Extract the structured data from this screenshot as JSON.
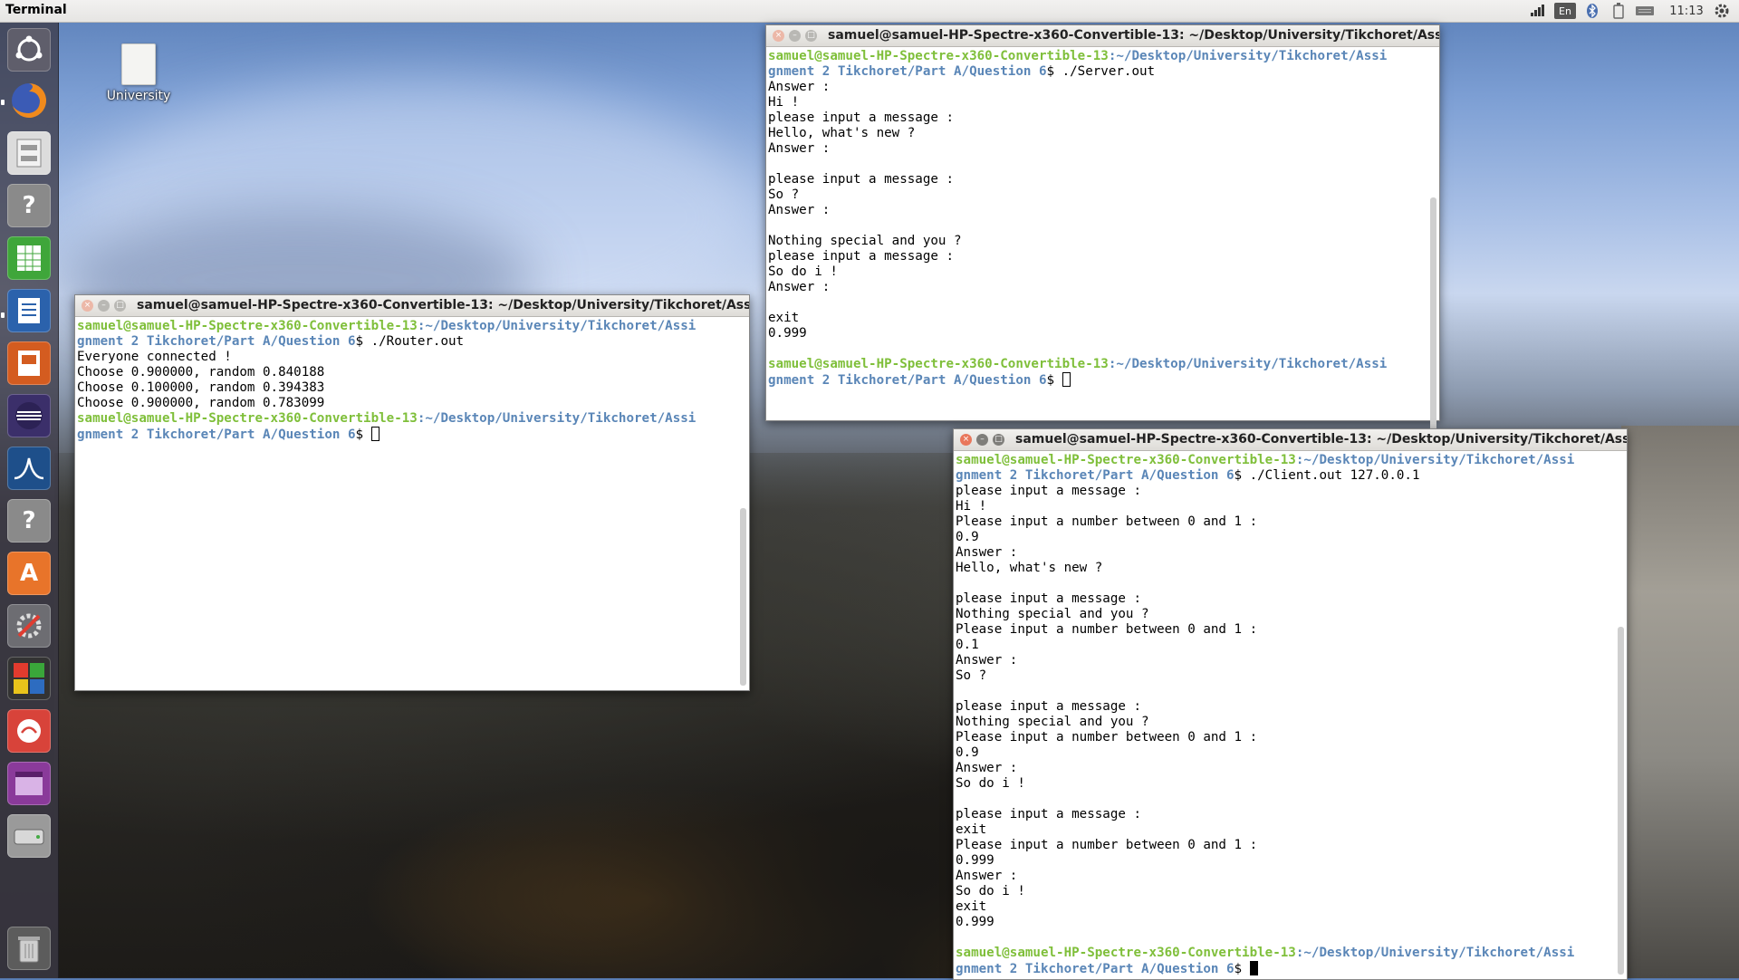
{
  "topbar": {
    "app_title": "Terminal",
    "keyboard_layout": "En",
    "clock": "11:13"
  },
  "launcher": {
    "items": [
      {
        "name": "Dash home",
        "icon": "ubuntu-logo-icon"
      },
      {
        "name": "Firefox",
        "icon": "firefox-icon"
      },
      {
        "name": "Files",
        "icon": "file-cabinet-icon"
      },
      {
        "name": "Unknown app",
        "icon": "question-mark-icon"
      },
      {
        "name": "LibreOffice Calc",
        "icon": "spreadsheet-icon"
      },
      {
        "name": "LibreOffice Writer",
        "icon": "document-icon"
      },
      {
        "name": "LibreOffice Impress",
        "icon": "presentation-icon"
      },
      {
        "name": "Eclipse",
        "icon": "eclipse-icon"
      },
      {
        "name": "MATLAB",
        "icon": "matlab-icon"
      },
      {
        "name": "Unknown app",
        "icon": "question-mark-icon"
      },
      {
        "name": "Ubuntu Software",
        "icon": "software-bag-icon"
      },
      {
        "name": "System Settings",
        "icon": "settings-wrench-icon"
      },
      {
        "name": "Workspace switcher",
        "icon": "workspaces-icon"
      },
      {
        "name": "Text editor",
        "icon": "text-editor-icon"
      },
      {
        "name": "Window app",
        "icon": "window-app-icon"
      },
      {
        "name": "Drive",
        "icon": "drive-icon"
      },
      {
        "name": "Trash",
        "icon": "trash-icon"
      }
    ]
  },
  "desktop": {
    "icon_label": "University"
  },
  "windows": {
    "server": {
      "title": "samuel@samuel-HP-Spectre-x360-Convertible-13: ~/Desktop/University/Tikchoret/Assignm",
      "lines": [
        {
          "u": "samuel@samuel-HP-Spectre-x360-Convertible-13",
          "p": ":~/Desktop/University/Tikchoret/Assi"
        },
        {
          "p": "gnment 2 Tikchoret/Part A/Question 6",
          "t": "$ ./Server.out"
        },
        {
          "t": "Answer :"
        },
        {
          "t": "Hi !"
        },
        {
          "t": "please input a message :"
        },
        {
          "t": "Hello, what's new ?"
        },
        {
          "t": "Answer :"
        },
        {
          "t": ""
        },
        {
          "t": "please input a message :"
        },
        {
          "t": "So ?"
        },
        {
          "t": "Answer :"
        },
        {
          "t": ""
        },
        {
          "t": "Nothing special and you ?"
        },
        {
          "t": "please input a message :"
        },
        {
          "t": "So do i !"
        },
        {
          "t": "Answer :"
        },
        {
          "t": ""
        },
        {
          "t": "exit"
        },
        {
          "t": "0.999"
        },
        {
          "t": ""
        },
        {
          "u": "samuel@samuel-HP-Spectre-x360-Convertible-13",
          "p": ":~/Desktop/University/Tikchoret/Assi"
        },
        {
          "p": "gnment 2 Tikchoret/Part A/Question 6",
          "t": "$ ",
          "cursor": "hollow"
        }
      ]
    },
    "router": {
      "title": "samuel@samuel-HP-Spectre-x360-Convertible-13: ~/Desktop/University/Tikchoret/Assignm",
      "lines": [
        {
          "u": "samuel@samuel-HP-Spectre-x360-Convertible-13",
          "p": ":~/Desktop/University/Tikchoret/Assi"
        },
        {
          "p": "gnment 2 Tikchoret/Part A/Question 6",
          "t": "$ ./Router.out"
        },
        {
          "t": "Everyone connected !"
        },
        {
          "t": "Choose 0.900000, random 0.840188"
        },
        {
          "t": "Choose 0.100000, random 0.394383"
        },
        {
          "t": "Choose 0.900000, random 0.783099"
        },
        {
          "u": "samuel@samuel-HP-Spectre-x360-Convertible-13",
          "p": ":~/Desktop/University/Tikchoret/Assi"
        },
        {
          "p": "gnment 2 Tikchoret/Part A/Question 6",
          "t": "$ ",
          "cursor": "hollow"
        }
      ]
    },
    "client": {
      "title": "samuel@samuel-HP-Spectre-x360-Convertible-13: ~/Desktop/University/Tikchoret/Assignm",
      "lines": [
        {
          "u": "samuel@samuel-HP-Spectre-x360-Convertible-13",
          "p": ":~/Desktop/University/Tikchoret/Assi"
        },
        {
          "p": "gnment 2 Tikchoret/Part A/Question 6",
          "t": "$ ./Client.out 127.0.0.1"
        },
        {
          "t": "please input a message :"
        },
        {
          "t": "Hi !"
        },
        {
          "t": "Please input a number between 0 and 1 :"
        },
        {
          "t": "0.9"
        },
        {
          "t": "Answer :"
        },
        {
          "t": "Hello, what's new ?"
        },
        {
          "t": ""
        },
        {
          "t": "please input a message :"
        },
        {
          "t": "Nothing special and you ?"
        },
        {
          "t": "Please input a number between 0 and 1 :"
        },
        {
          "t": "0.1"
        },
        {
          "t": "Answer :"
        },
        {
          "t": "So ?"
        },
        {
          "t": ""
        },
        {
          "t": "please input a message :"
        },
        {
          "t": "Nothing special and you ?"
        },
        {
          "t": "Please input a number between 0 and 1 :"
        },
        {
          "t": "0.9"
        },
        {
          "t": "Answer :"
        },
        {
          "t": "So do i !"
        },
        {
          "t": ""
        },
        {
          "t": "please input a message :"
        },
        {
          "t": "exit"
        },
        {
          "t": "Please input a number between 0 and 1 :"
        },
        {
          "t": "0.999"
        },
        {
          "t": "Answer :"
        },
        {
          "t": "So do i !"
        },
        {
          "t": "exit"
        },
        {
          "t": "0.999"
        },
        {
          "t": ""
        },
        {
          "u": "samuel@samuel-HP-Spectre-x360-Convertible-13",
          "p": ":~/Desktop/University/Tikchoret/Assi"
        },
        {
          "p": "gnment 2 Tikchoret/Part A/Question 6",
          "t": "$ ",
          "cursor": "solid"
        }
      ]
    }
  }
}
